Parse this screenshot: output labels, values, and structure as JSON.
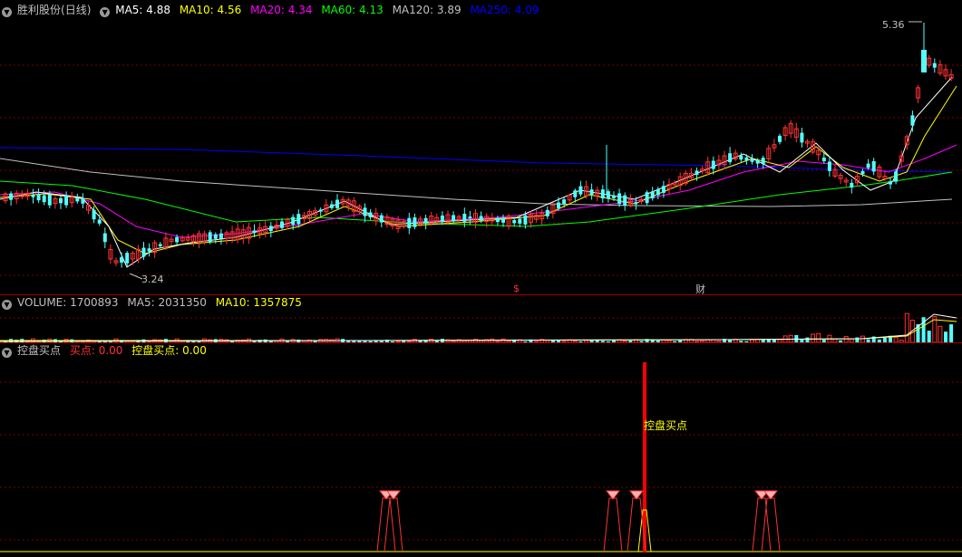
{
  "stock": {
    "name": "胜利股份",
    "period": "(日线)"
  },
  "ma_header": {
    "ma5": {
      "label": "MA5: 4.88",
      "color": "#ffffff"
    },
    "ma10": {
      "label": "MA10: 4.56",
      "color": "#ffff00"
    },
    "ma20": {
      "label": "MA20: 4.34",
      "color": "#ff00ff"
    },
    "ma60": {
      "label": "MA60: 4.13",
      "color": "#00ff00"
    },
    "ma120": {
      "label": "MA120: 3.89",
      "color": "#c0c0c0"
    },
    "ma250": {
      "label": "MA250: 4.09",
      "color": "#0000ff"
    }
  },
  "price_annotations": {
    "high": "5.36",
    "low": "3.24"
  },
  "event_markers": {
    "s_marker": "$",
    "cai_marker": "财"
  },
  "volume_header": {
    "volume": "VOLUME: 1700893",
    "ma5": "MA5: 2031350",
    "ma10": "MA10: 1357875"
  },
  "indicator_header": {
    "name": "控盘买点",
    "buy_point": "买点: 0.00",
    "control_buy_point": "控盘买点: 0.00"
  },
  "indicator_signal_label": "控盘买点",
  "colors": {
    "up": "#ff3232",
    "down": "#54ffff",
    "grid": "#7a0000",
    "signal": "#ff0000"
  }
}
